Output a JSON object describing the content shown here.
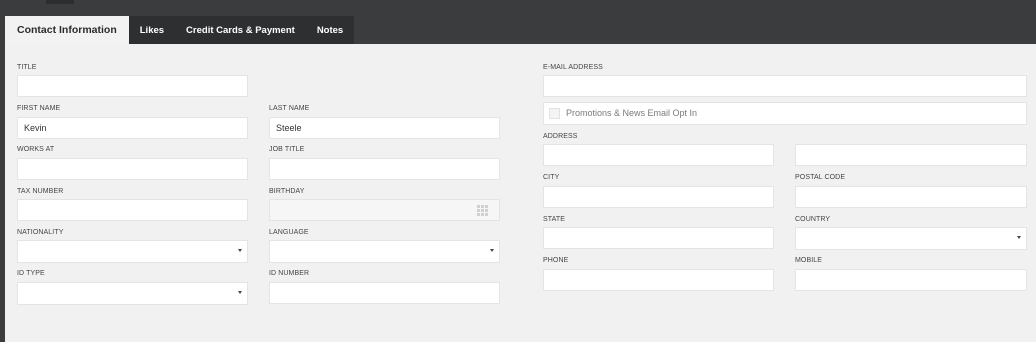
{
  "tabs": [
    {
      "label": "Contact Information",
      "active": true
    },
    {
      "label": "Likes",
      "active": false
    },
    {
      "label": "Credit Cards & Payment",
      "active": false
    },
    {
      "label": "Notes",
      "active": false
    }
  ],
  "left": {
    "title": {
      "label": "TITLE",
      "value": ""
    },
    "first_name": {
      "label": "FIRST NAME",
      "value": "Kevin"
    },
    "last_name": {
      "label": "LAST NAME",
      "value": "Steele"
    },
    "works_at": {
      "label": "WORKS AT",
      "value": ""
    },
    "job_title": {
      "label": "JOB TITLE",
      "value": ""
    },
    "tax_number": {
      "label": "TAX NUMBER",
      "value": ""
    },
    "birthday": {
      "label": "BIRTHDAY",
      "value": "",
      "icon": "calendar-grid-icon"
    },
    "nationality": {
      "label": "NATIONALITY",
      "value": ""
    },
    "language": {
      "label": "LANGUAGE",
      "value": ""
    },
    "id_type": {
      "label": "ID TYPE",
      "value": ""
    },
    "id_number": {
      "label": "ID NUMBER",
      "value": ""
    }
  },
  "right": {
    "email": {
      "label": "E-MAIL ADDRESS",
      "value": ""
    },
    "optin": {
      "label": "Promotions & News Email Opt In",
      "checked": false
    },
    "address": {
      "label": "ADDRESS",
      "value1": "",
      "value2": ""
    },
    "city": {
      "label": "CITY",
      "value": ""
    },
    "postal_code": {
      "label": "POSTAL CODE",
      "value": ""
    },
    "state": {
      "label": "STATE",
      "value": ""
    },
    "country": {
      "label": "COUNTRY",
      "value": ""
    },
    "phone": {
      "label": "PHONE",
      "value": ""
    },
    "mobile": {
      "label": "MOBILE",
      "value": ""
    }
  },
  "colors": {
    "dark": "#3b3c3e",
    "tab_bg": "#2e2f31",
    "panel": "#f1f1f1"
  }
}
